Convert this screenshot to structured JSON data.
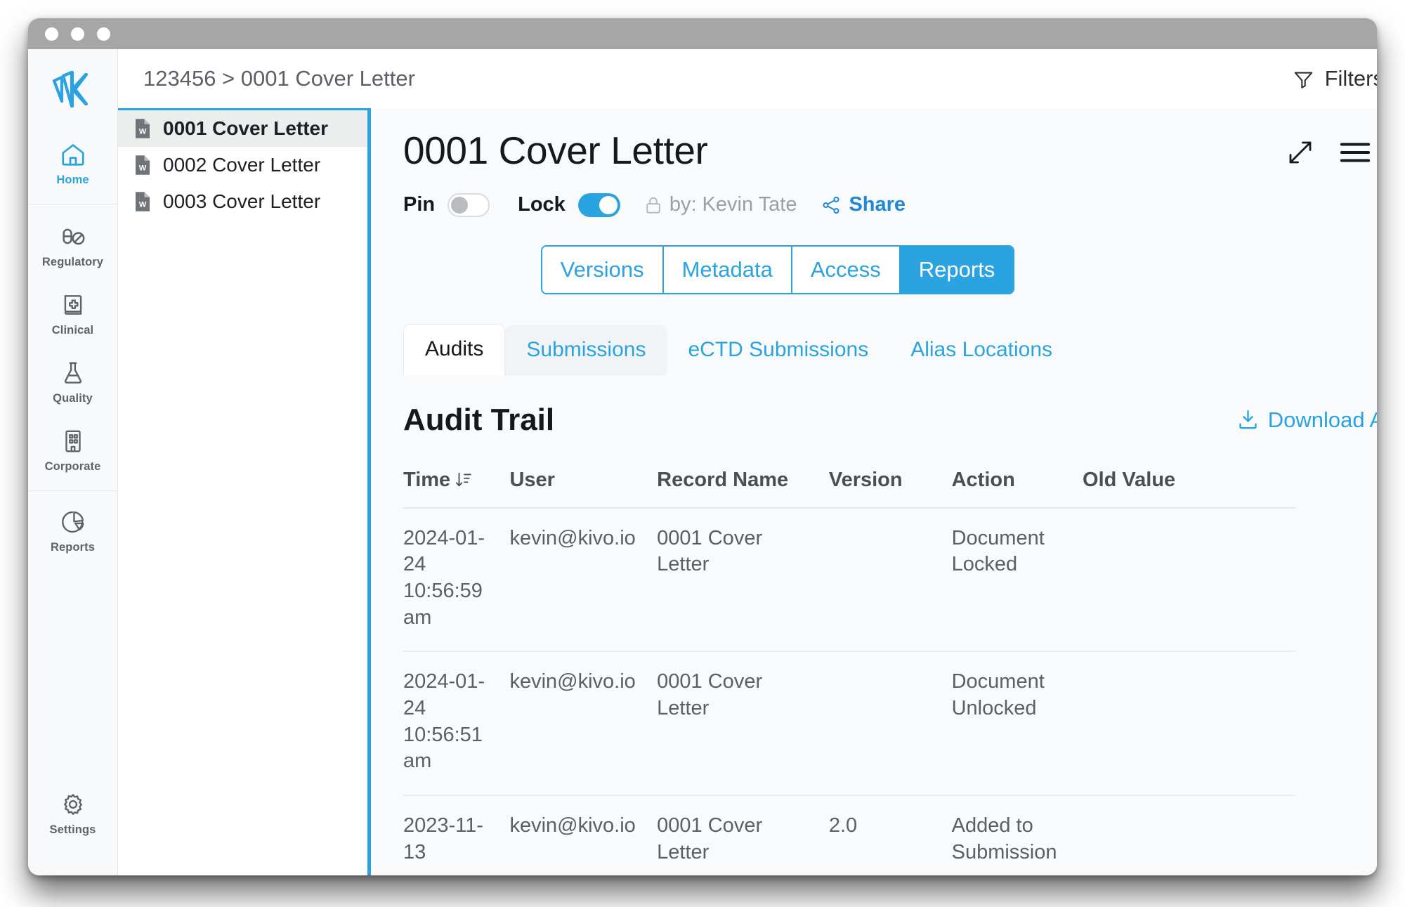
{
  "window": {
    "traffic_lights": [
      "close",
      "minimize",
      "maximize"
    ]
  },
  "rail": {
    "logo_name": "kivo-logo",
    "items": [
      {
        "label": "Home",
        "icon": "home-icon",
        "active": true
      },
      {
        "label": "Regulatory",
        "icon": "pill-icon",
        "active": false
      },
      {
        "label": "Clinical",
        "icon": "medical-book-icon",
        "active": false
      },
      {
        "label": "Quality",
        "icon": "flask-icon",
        "active": false
      },
      {
        "label": "Corporate",
        "icon": "building-icon",
        "active": false
      },
      {
        "label": "Reports",
        "icon": "pie-chart-icon",
        "active": false
      }
    ],
    "bottom_item": {
      "label": "Settings",
      "icon": "gear-icon"
    }
  },
  "topbar": {
    "breadcrumb": "123456 > 0001 Cover Letter",
    "filters_label": "Filters",
    "filters_icon": "funnel-icon"
  },
  "doclist": {
    "items": [
      {
        "name": "0001 Cover Letter",
        "icon": "word-document-icon",
        "selected": true
      },
      {
        "name": "0002 Cover Letter",
        "icon": "word-document-icon",
        "selected": false
      },
      {
        "name": "0003 Cover Letter",
        "icon": "word-document-icon",
        "selected": false
      }
    ]
  },
  "detail": {
    "title": "0001 Cover Letter",
    "expand_icon": "expand-arrows-icon",
    "menu_icon": "hamburger-menu-icon",
    "pin_label": "Pin",
    "pin_state": "off",
    "lock_label": "Lock",
    "lock_state": "on",
    "lock_icon": "lock-icon",
    "locked_by": "by: Kevin Tate",
    "share_label": "Share",
    "share_icon": "share-nodes-icon",
    "segments": [
      {
        "label": "Versions",
        "active": false
      },
      {
        "label": "Metadata",
        "active": false
      },
      {
        "label": "Access",
        "active": false
      },
      {
        "label": "Reports",
        "active": true
      }
    ],
    "tabs": [
      {
        "label": "Audits",
        "active": true
      },
      {
        "label": "Submissions",
        "active": false
      },
      {
        "label": "eCTD Submissions",
        "active": false
      },
      {
        "label": "Alias Locations",
        "active": false
      }
    ]
  },
  "audit": {
    "heading": "Audit Trail",
    "download_label": "Download Audit L",
    "download_icon": "download-icon",
    "sort_icon": "sort-descending-icon",
    "columns": [
      "Time",
      "User",
      "Record Name",
      "Version",
      "Action",
      "Old Value"
    ],
    "rows": [
      {
        "time": "2024-01-24 10:56:59 am",
        "user": "kevin@kivo.io",
        "record_name": "0001 Cover Letter",
        "version": "",
        "action": "Document Locked",
        "old_value": ""
      },
      {
        "time": "2024-01-24 10:56:51 am",
        "user": "kevin@kivo.io",
        "record_name": "0001 Cover Letter",
        "version": "",
        "action": "Document Unlocked",
        "old_value": ""
      },
      {
        "time": "2023-11-13",
        "user": "kevin@kivo.io",
        "record_name": "0001 Cover Letter",
        "version": "2.0",
        "action": "Added to Submission",
        "old_value": ""
      }
    ]
  },
  "colors": {
    "accent": "#2ba3e0",
    "link": "#2089d6",
    "titlebar": "#a6a6a6",
    "rail_bg": "#f7f9fa",
    "detail_bg": "#f8fafb",
    "selected_row": "#eceded"
  }
}
